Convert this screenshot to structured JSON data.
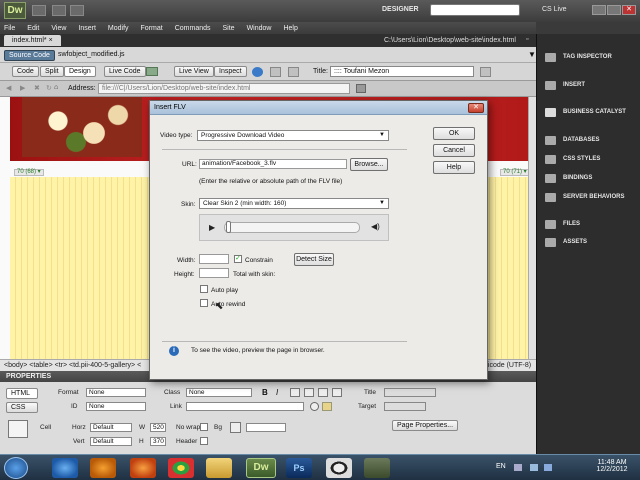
{
  "app": {
    "logo": "Dw",
    "workspace": "DESIGNER",
    "cslive": "CS Live",
    "menu": [
      "File",
      "Edit",
      "View",
      "Insert",
      "Modify",
      "Format",
      "Commands",
      "Site",
      "Window",
      "Help"
    ]
  },
  "document": {
    "tab": "index.html*",
    "path": "C:\\Users\\Lion\\Desktop\\web-site\\index.html",
    "source_code": "Source Code",
    "related_file": "swfobject_modified.js",
    "toolbar": {
      "code": "Code",
      "split": "Split",
      "design": "Design",
      "live_code": "Live Code",
      "live_view": "Live View",
      "inspect": "Inspect",
      "title_label": "Title:",
      "title_value": ":::: Toufani Mezon"
    },
    "address_label": "Address:",
    "address_value": "file:///C|/Users/Lion/Desktop/web-site/index.html",
    "ruler_left": "70 (68) ▾",
    "ruler_right": "70 (71) ▾",
    "tag_selector": "<body> <table> <tr> <td.pii-400-5-gallery> <",
    "encoding": "nicode (UTF-8)"
  },
  "properties": {
    "header": "PROPERTIES",
    "html_btn": "HTML",
    "css_btn": "CSS",
    "format_label": "Format",
    "format_value": "None",
    "id_label": "ID",
    "id_value": "None",
    "class_label": "Class",
    "class_value": "None",
    "link_label": "Link",
    "title_label": "Title",
    "target_label": "Target",
    "cell_label": "Cell",
    "horz_label": "Horz",
    "horz_value": "Default",
    "vert_label": "Vert",
    "vert_value": "Default",
    "w_label": "W",
    "w_value": "520",
    "h_label": "H",
    "h_value": "370",
    "nowrap_label": "No wrap",
    "header_label": "Header",
    "bg_label": "Bg",
    "page_props": "Page Properties..."
  },
  "right_panel": [
    {
      "label": "TAG INSPECTOR",
      "icon": "tag-inspector-icon"
    },
    {
      "label": "INSERT",
      "icon": "insert-icon"
    },
    {
      "label": "BUSINESS CATALYST",
      "icon": "business-catalyst-icon"
    },
    {
      "label": "DATABASES",
      "icon": "database-icon"
    },
    {
      "label": "CSS STYLES",
      "icon": "css-styles-icon"
    },
    {
      "label": "BINDINGS",
      "icon": "bindings-icon"
    },
    {
      "label": "SERVER BEHAVIORS",
      "icon": "server-behaviors-icon"
    },
    {
      "label": "FILES",
      "icon": "files-icon"
    },
    {
      "label": "ASSETS",
      "icon": "assets-icon"
    }
  ],
  "dialog": {
    "title": "Insert FLV",
    "video_type_label": "Video type:",
    "video_type_value": "Progressive Download Video",
    "url_label": "URL:",
    "url_value": "animation/Facebook_3.flv",
    "browse": "Browse...",
    "url_hint": "(Enter the relative or absolute path of the FLV file)",
    "skin_label": "Skin:",
    "skin_value": "Clear Skin 2 (min width: 160)",
    "width_label": "Width:",
    "height_label": "Height:",
    "constrain_label": "Constrain",
    "constrain_checked": true,
    "detect_size": "Detect Size",
    "total_with_skin": "Total with skin:",
    "auto_play_label": "Auto play",
    "auto_rewind_label": "Auto rewind",
    "info_text": "To see the video, preview the page in browser.",
    "ok": "OK",
    "cancel": "Cancel",
    "help": "Help"
  },
  "taskbar": {
    "lang": "EN",
    "time": "11:48 AM",
    "date": "12/2/2012"
  },
  "colors": {
    "accent_red": "#b81c1c",
    "page_yellow": "#fff3a8",
    "dialog_bg": "#ecebe8"
  }
}
